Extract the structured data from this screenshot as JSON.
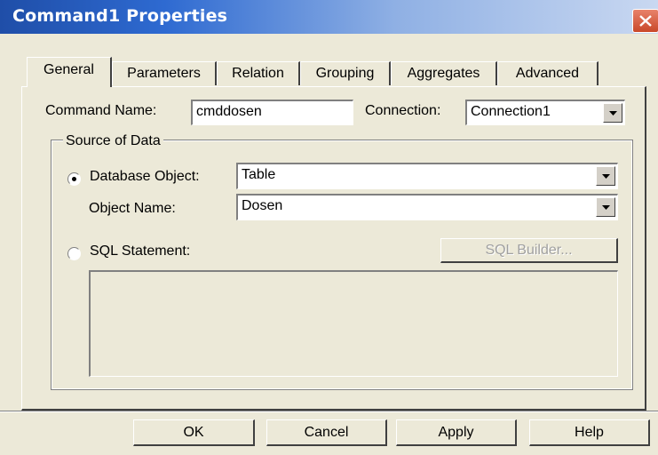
{
  "window": {
    "title": "Command1 Properties"
  },
  "tabs": [
    "General",
    "Parameters",
    "Relation",
    "Grouping",
    "Aggregates",
    "Advanced"
  ],
  "general": {
    "command_name_label": "Command Name:",
    "command_name_value": "cmddosen",
    "connection_label": "Connection:",
    "connection_value": "Connection1",
    "source_group_label": "Source of Data",
    "database_object_label": "Database Object:",
    "database_object_value": "Table",
    "object_name_label": "Object Name:",
    "object_name_value": "Dosen",
    "sql_statement_label": "SQL Statement:",
    "sql_builder_label": "SQL Builder...",
    "selected_source": "Database Object"
  },
  "buttons": {
    "ok": "OK",
    "cancel": "Cancel",
    "apply": "Apply",
    "help": "Help"
  },
  "icons": {
    "close": "close-icon",
    "dropdown": "chevron-down-icon"
  },
  "colors": {
    "title_bar_start": "#1f4ea8",
    "title_bar_end": "#c9d8f1",
    "close_button": "#d25a3c",
    "dialog_face": "#ece9d8"
  }
}
